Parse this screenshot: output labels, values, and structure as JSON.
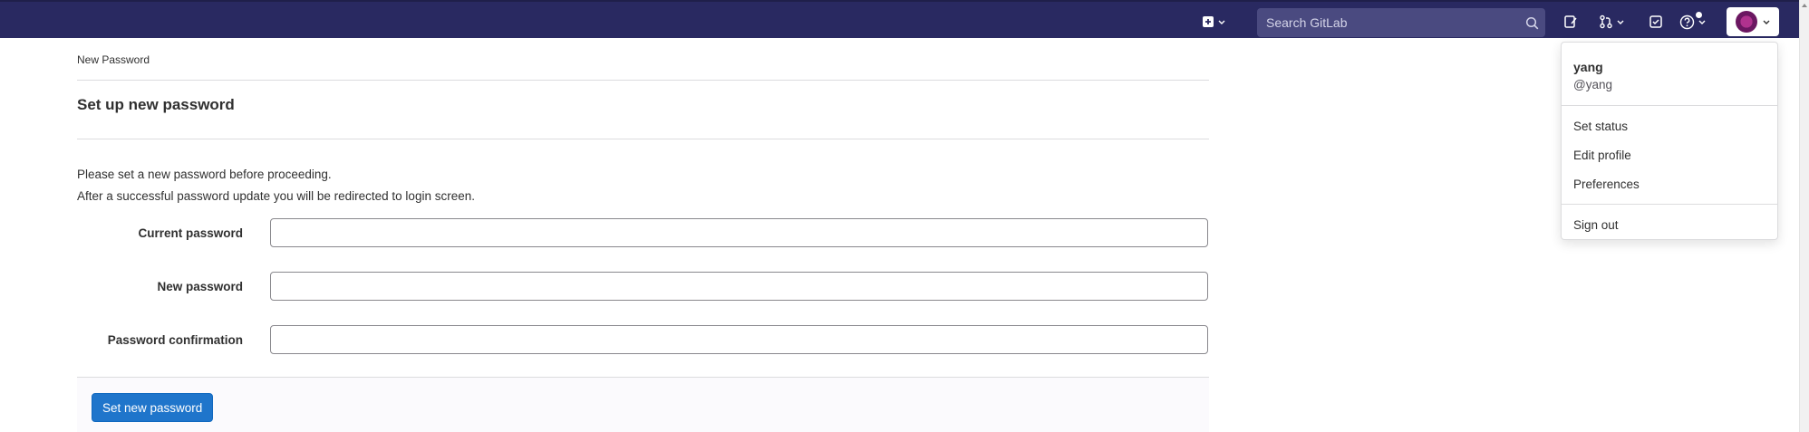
{
  "navbar": {
    "search_placeholder": "Search GitLab",
    "icons": [
      "plus-square-icon",
      "chevron-down-icon",
      "search-icon",
      "issues-icon",
      "merge-request-icon",
      "todo-icon",
      "help-icon",
      "avatar"
    ],
    "background": "#292961"
  },
  "breadcrumb": "New Password",
  "title": "Set up new password",
  "intro": {
    "line1": "Please set a new password before proceeding.",
    "line2": "After a successful password update you will be redirected to login screen."
  },
  "form": {
    "current_password_label": "Current password",
    "current_password_value": "",
    "new_password_label": "New password",
    "new_password_value": "",
    "confirmation_label": "Password confirmation",
    "confirmation_value": "",
    "submit_label": "Set new password"
  },
  "dropdown": {
    "name": "yang",
    "handle": "@yang",
    "items": [
      "Set status",
      "Edit profile",
      "Preferences"
    ],
    "sign_out": "Sign out"
  },
  "colors": {
    "primary": "#1f75cb",
    "nav": "#292961"
  }
}
